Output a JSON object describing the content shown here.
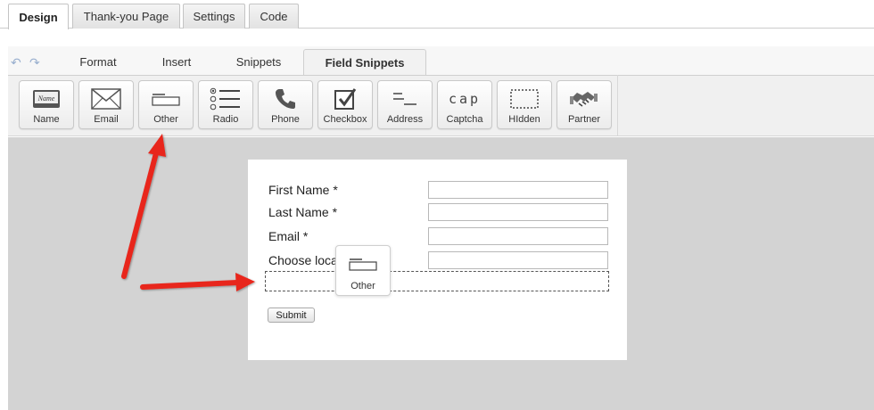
{
  "top_tabs": [
    "Design",
    "Thank-you Page",
    "Settings",
    "Code"
  ],
  "sub_tabs": [
    "Format",
    "Insert",
    "Snippets",
    "Field Snippets"
  ],
  "snippets": [
    "Name",
    "Email",
    "Other",
    "Radio",
    "Phone",
    "Checkbox",
    "Address",
    "Captcha",
    "HIdden",
    "Partner"
  ],
  "form": {
    "fields": [
      "First Name *",
      "Last Name *",
      "Email *",
      "Choose loca"
    ],
    "submit": "Submit"
  },
  "drag_ghost_label": "Other",
  "captcha_glyph": "cap",
  "colors": {
    "arrow": "#e8261b",
    "canvas": "#d3d3d3"
  }
}
